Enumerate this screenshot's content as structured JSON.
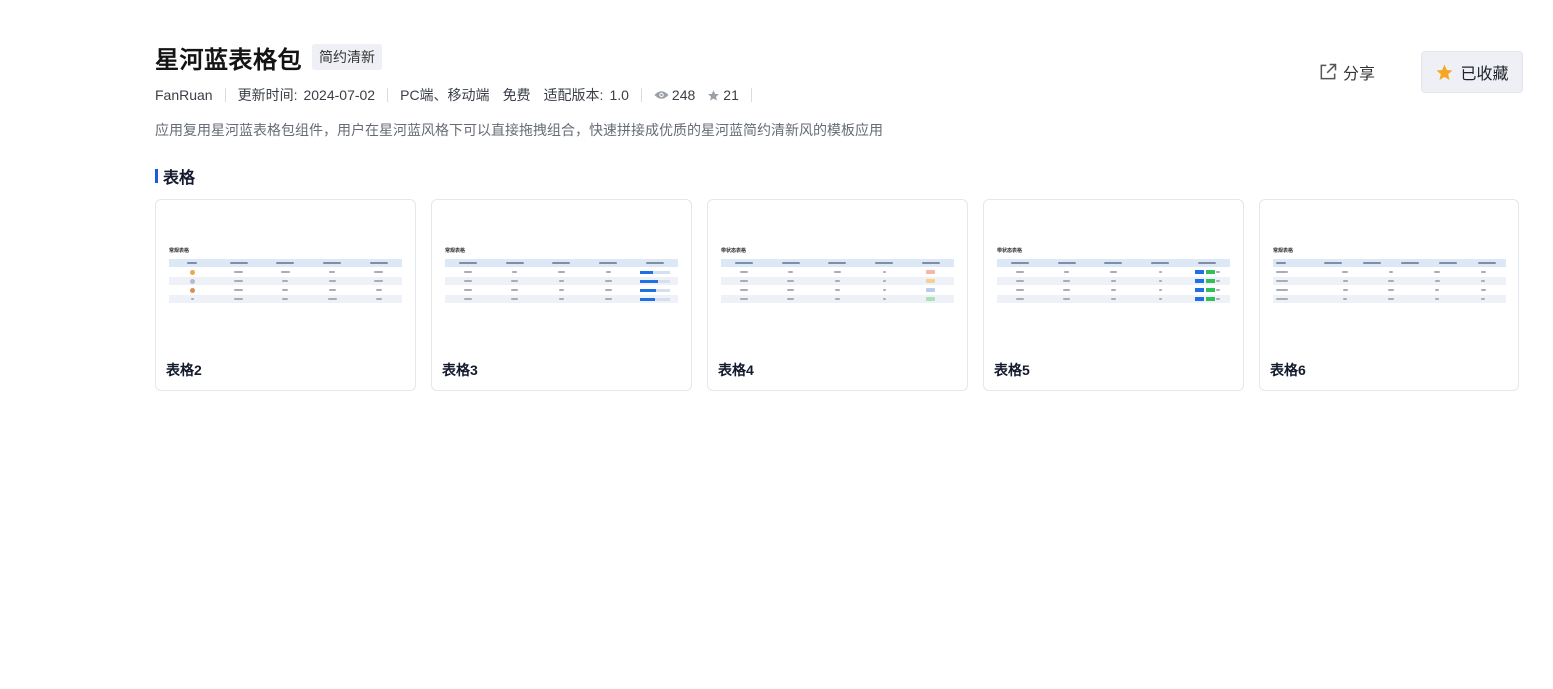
{
  "header": {
    "title": "星河蓝表格包",
    "tag": "简约清新",
    "author": "FanRuan",
    "update_label": "更新时间:",
    "update_date": "2024-07-02",
    "platform": "PC端、移动端",
    "price": "免费",
    "version_label": "适配版本:",
    "version": "1.0",
    "views": "248",
    "stars": "21",
    "description": "应用复用星河蓝表格包组件，用户在星河蓝风格下可以直接拖拽组合，快速拼接成优质的星河蓝简约清新风的模板应用"
  },
  "actions": {
    "share_label": "分享",
    "favorite_label": "已收藏"
  },
  "section": {
    "title": "表格"
  },
  "cards": [
    {
      "label": "表格2",
      "thumb_title": "常规表格"
    },
    {
      "label": "表格3",
      "thumb_title": "常规表格"
    },
    {
      "label": "表格4",
      "thumb_title": "带状态表格"
    },
    {
      "label": "表格5",
      "thumb_title": "带状态表格"
    },
    {
      "label": "表格6",
      "thumb_title": "常规表格"
    }
  ],
  "colors": {
    "accent": "#1f5bd8",
    "favorite_star": "#f5a623",
    "tag_bg": "#eef0f5"
  },
  "icons": {
    "share": "external-link-icon",
    "favorite": "star-icon",
    "views": "eye-icon",
    "stars": "star-icon"
  }
}
